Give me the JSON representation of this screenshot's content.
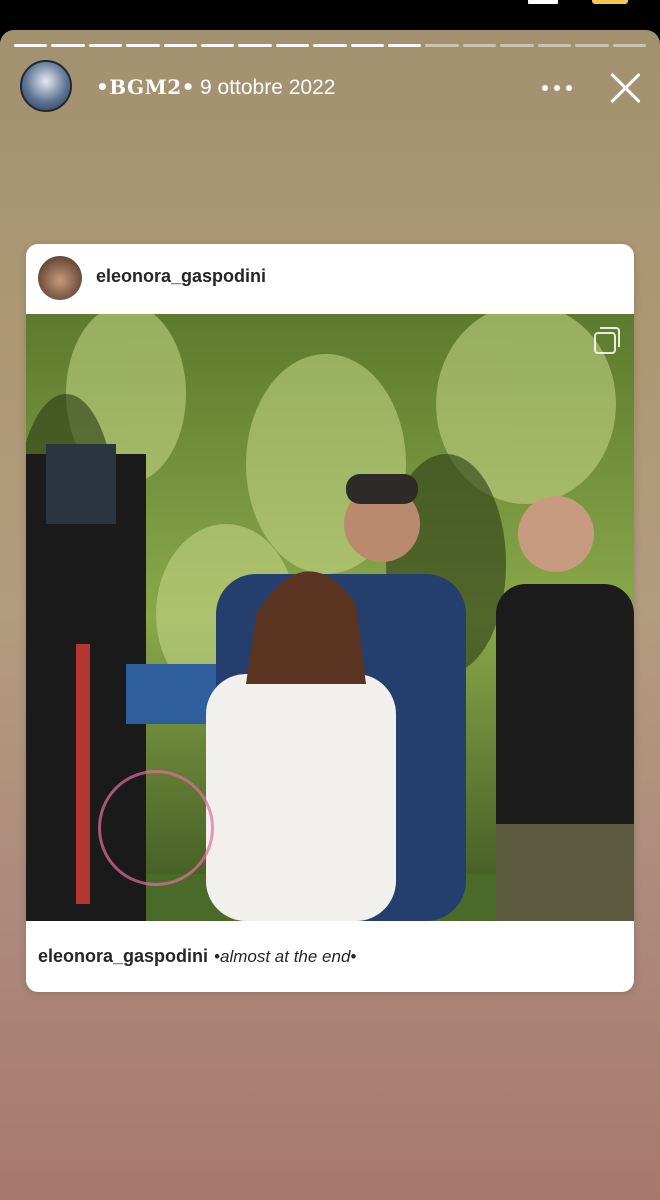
{
  "story": {
    "account_name": "•BGM2•",
    "date": "9 ottobre 2022",
    "progress_total": 17,
    "progress_done": 11
  },
  "post": {
    "username": "eleonora_gaspodini",
    "caption_user": "eleonora_gaspodini",
    "caption_text": "•almost at the end•"
  },
  "icons": [
    "more-icon",
    "close-icon",
    "carousel-icon"
  ],
  "colors": {
    "story_bg_top": "#a2916f",
    "story_bg_bottom": "#a7796c",
    "card_bg": "#ffffff"
  }
}
